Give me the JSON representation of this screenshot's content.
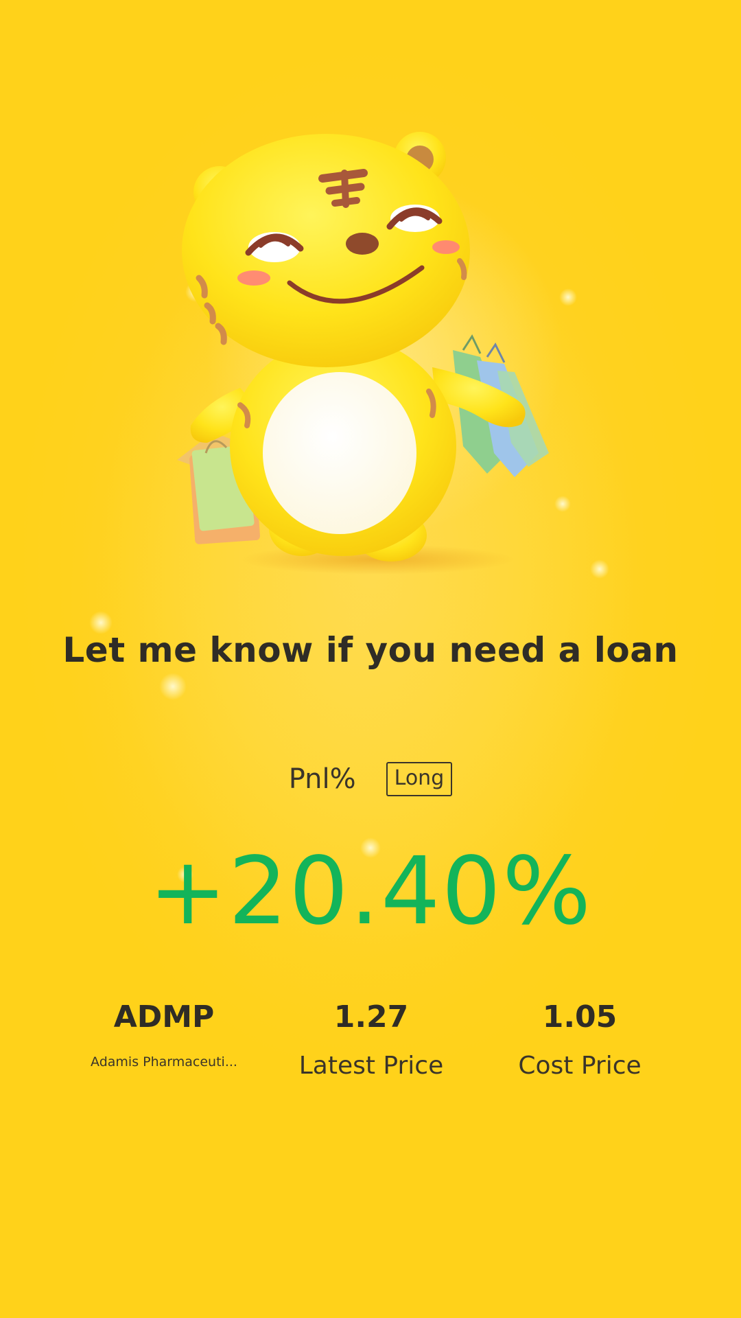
{
  "mascot": {
    "icon": "tiger-mascot-with-shopping-bags-icon"
  },
  "headline": "Let me know if you need a loan",
  "pnl": {
    "label": "Pnl%",
    "direction": "Long",
    "value": "+20.40%"
  },
  "stock": {
    "symbol": "ADMP",
    "name": "Adamis Pharmaceuti...",
    "latest_price": "1.27",
    "latest_price_label": "Latest Price",
    "cost_price": "1.05",
    "cost_price_label": "Cost Price"
  },
  "colors": {
    "background": "#ffd32a",
    "gain": "#13b45a",
    "text": "#2f2c26"
  }
}
